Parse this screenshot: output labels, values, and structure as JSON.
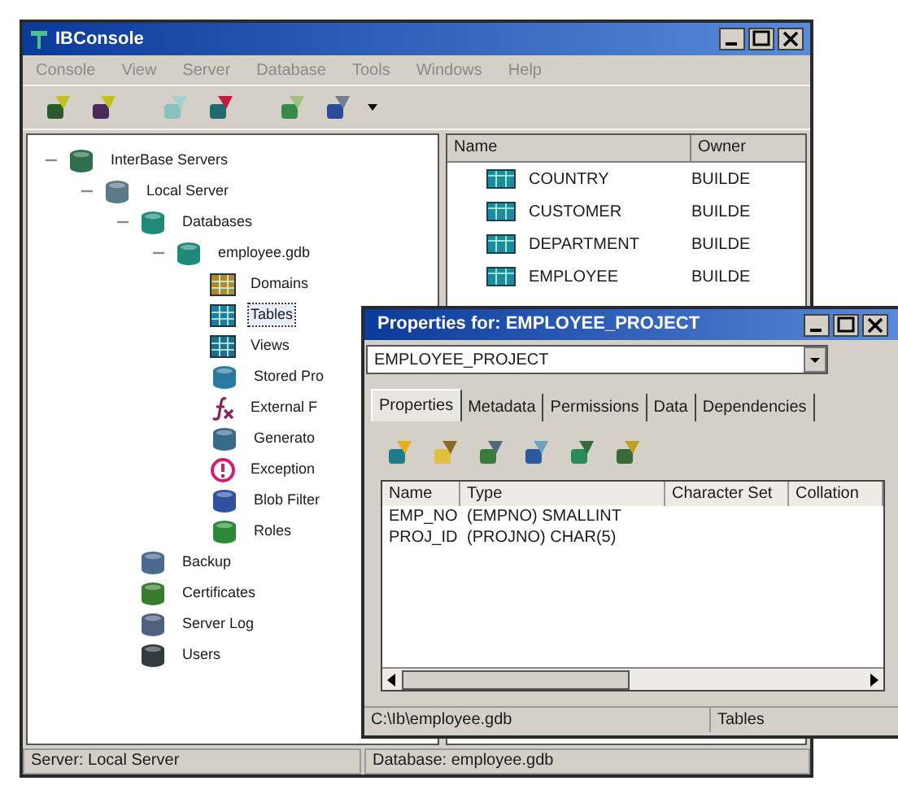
{
  "main_window": {
    "title": "IBConsole",
    "menu": [
      "Console",
      "View",
      "Server",
      "Database",
      "Tools",
      "Windows",
      "Help"
    ],
    "tree": [
      {
        "label": "InterBase Servers",
        "expanded": true,
        "selected": false,
        "children": [
          {
            "label": "Local Server",
            "expanded": true,
            "selected": false,
            "children": [
              {
                "label": "Databases",
                "expanded": true,
                "selected": false,
                "children": [
                  {
                    "label": "employee.gdb",
                    "expanded": true,
                    "selected": false,
                    "children": [
                      {
                        "label": "Domains",
                        "selected": false
                      },
                      {
                        "label": "Tables",
                        "selected": true
                      },
                      {
                        "label": "Views",
                        "selected": false
                      },
                      {
                        "label": "Stored Pro",
                        "selected": false
                      },
                      {
                        "label": "External F",
                        "selected": false
                      },
                      {
                        "label": "Generato",
                        "selected": false
                      },
                      {
                        "label": "Exception",
                        "selected": false
                      },
                      {
                        "label": "Blob Filter",
                        "selected": false
                      },
                      {
                        "label": "Roles",
                        "selected": false
                      }
                    ]
                  }
                ]
              },
              {
                "label": "Backup",
                "selected": false
              },
              {
                "label": "Certificates",
                "selected": false
              },
              {
                "label": "Server Log",
                "selected": false
              },
              {
                "label": "Users",
                "selected": false
              }
            ]
          }
        ]
      }
    ],
    "list": {
      "columns": [
        "Name",
        "Owner"
      ],
      "rows": [
        {
          "name": "COUNTRY",
          "owner": "BUILDE"
        },
        {
          "name": "CUSTOMER",
          "owner": "BUILDE"
        },
        {
          "name": "DEPARTMENT",
          "owner": "BUILDE"
        },
        {
          "name": "EMPLOYEE",
          "owner": "BUILDE"
        }
      ]
    },
    "status_bar": [
      "Server: Local Server",
      "Database: employee.gdb"
    ]
  },
  "properties_window": {
    "title": "Properties for: EMPLOYEE_PROJECT",
    "combo_value": "EMPLOYEE_PROJECT",
    "tabs": [
      {
        "label": "Properties",
        "selected": true
      },
      {
        "label": "Metadata",
        "selected": false
      },
      {
        "label": "Permissions",
        "selected": false
      },
      {
        "label": "Data",
        "selected": false
      },
      {
        "label": "Dependencies",
        "selected": false
      }
    ],
    "grid": {
      "columns": [
        "Name",
        "Type",
        "Character Set",
        "Collation"
      ],
      "rows": [
        {
          "name": "EMP_NO",
          "type": "(EMPNO) SMALLINT"
        },
        {
          "name": "PROJ_ID",
          "type": "(PROJNO) CHAR(5)"
        }
      ]
    },
    "status_bar": [
      "C:\\Ib\\employee.gdb",
      "Tables"
    ]
  }
}
